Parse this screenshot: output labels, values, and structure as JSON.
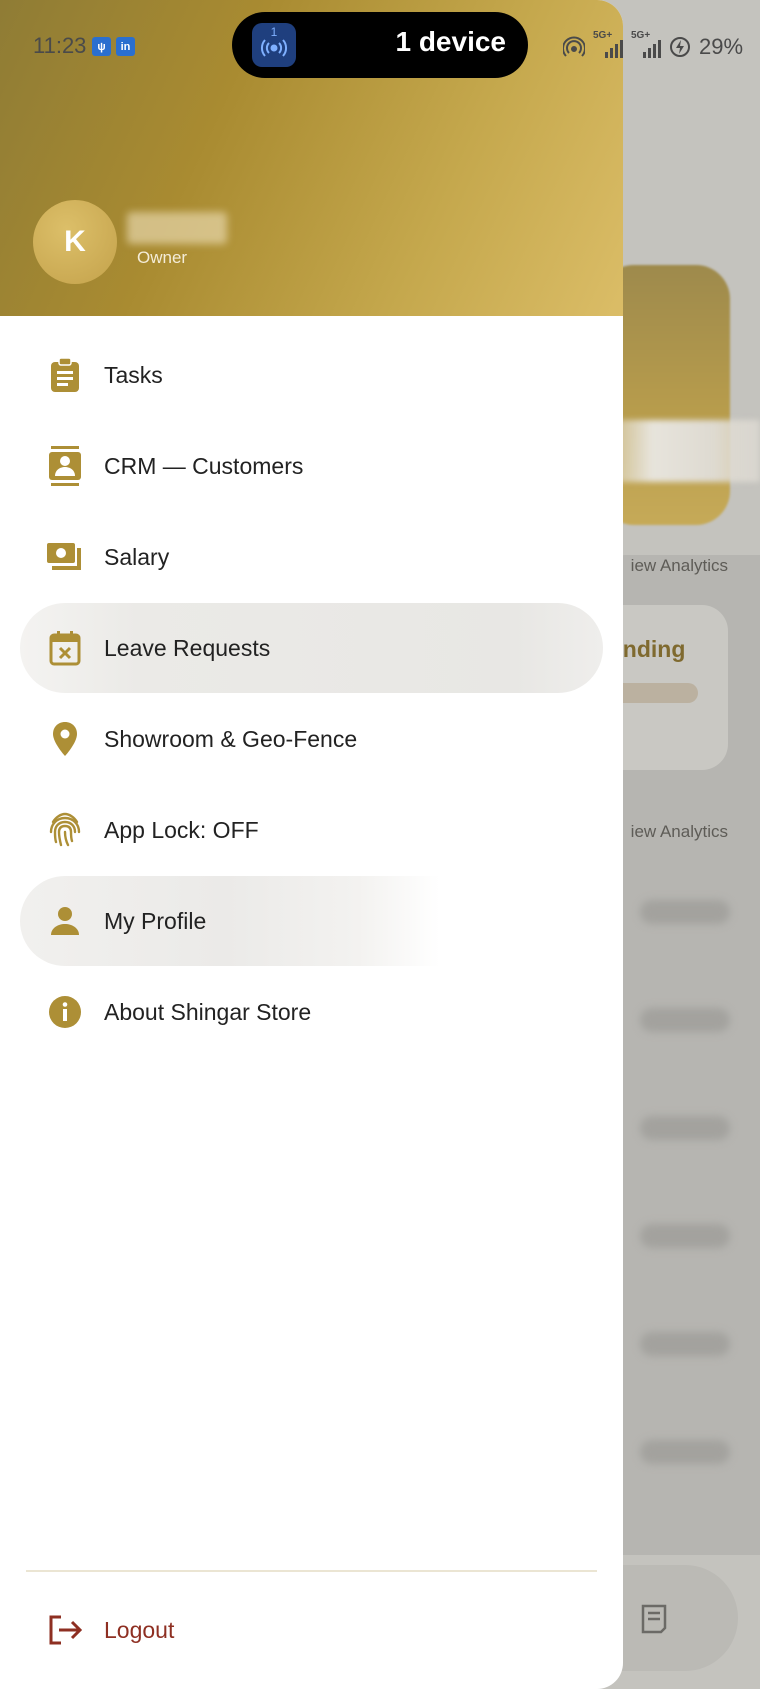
{
  "status_bar": {
    "time": "11:23",
    "notification_icons": [
      "usb-icon",
      "linkedin-icon"
    ],
    "island_badge": "1",
    "island_text": "1 device",
    "network_1": "5G+",
    "network_2": "5G+",
    "battery": "29%"
  },
  "drawer": {
    "avatar_initial": "K",
    "role": "Owner",
    "menu_items": [
      {
        "label": "Tasks",
        "icon": "clipboard-icon"
      },
      {
        "label": "CRM — Customers",
        "icon": "contact-card-icon"
      },
      {
        "label": "Salary",
        "icon": "money-icon"
      },
      {
        "label": "Leave Requests",
        "icon": "calendar-x-icon"
      },
      {
        "label": "Showroom & Geo-Fence",
        "icon": "location-pin-icon"
      },
      {
        "label": "App Lock: OFF",
        "icon": "fingerprint-icon"
      },
      {
        "label": "My Profile",
        "icon": "person-icon"
      },
      {
        "label": "About Shingar Store",
        "icon": "info-icon"
      }
    ],
    "logout_label": "Logout"
  },
  "background": {
    "view_analytics_1": "iew Analytics",
    "view_analytics_2": "iew Analytics",
    "pending": "ending"
  },
  "colors": {
    "accent": "#ad8f36",
    "logout": "#8e2f22",
    "header_start": "#8f7c35",
    "header_end": "#dbbd67"
  }
}
